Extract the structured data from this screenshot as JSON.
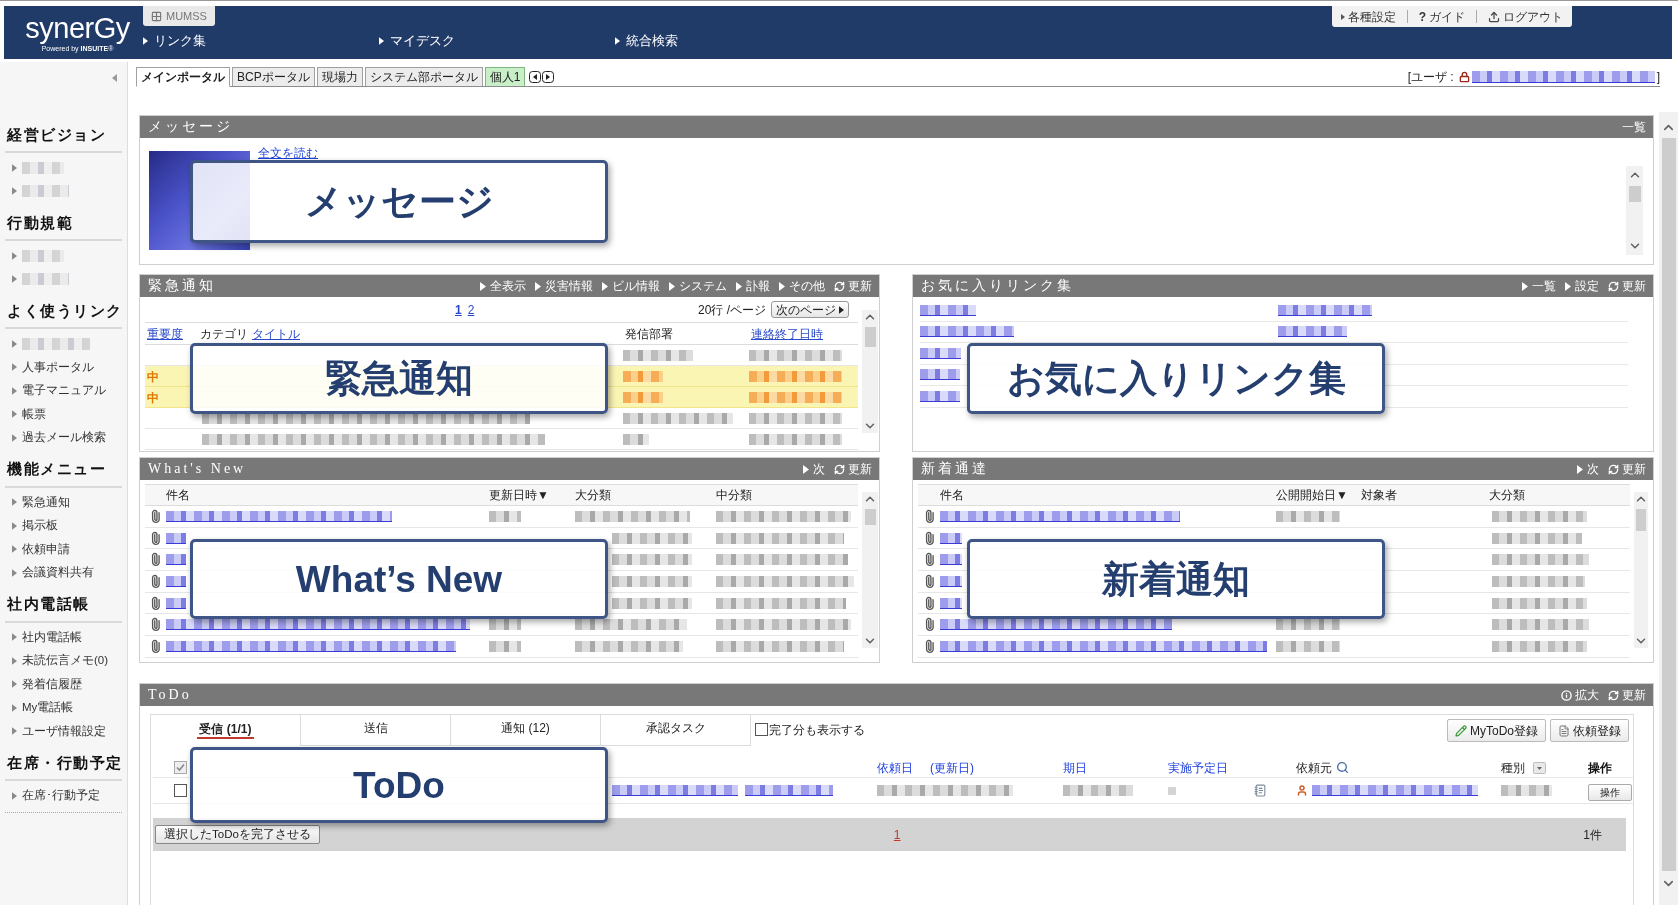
{
  "header": {
    "logo": "synerGy",
    "tagline": "Powered by **INSUITE**®",
    "app_tab": "MUMSS",
    "nav": [
      "リンク集",
      "マイデスク",
      "統合検索"
    ],
    "utility_links": [
      {
        "kind": "settings",
        "label": "各種設定"
      },
      {
        "kind": "guide",
        "symbol": "?",
        "label": "ガイド"
      },
      {
        "kind": "logout",
        "label": "ログアウト"
      }
    ]
  },
  "portal_tabs": [
    {
      "label": "メインポータル",
      "kind": "shared",
      "selected": true
    },
    {
      "label": "BCPポータル",
      "kind": "shared",
      "selected": false
    },
    {
      "label": "現場力",
      "kind": "shared",
      "selected": false
    },
    {
      "label": "システム部ポータル",
      "kind": "shared",
      "selected": false
    },
    {
      "label": "個人1",
      "kind": "personal",
      "selected": false
    }
  ],
  "user": {
    "label": "[ユーザ :",
    "closing": "]"
  },
  "sidebar": {
    "sections": [
      {
        "title": "経営ビジョン",
        "items": [
          {
            "kind": "redacted"
          },
          {
            "kind": "redacted"
          }
        ]
      },
      {
        "title": "行動規範",
        "items": [
          {
            "kind": "redacted"
          },
          {
            "kind": "redacted"
          }
        ]
      },
      {
        "title": "よく使うリンク",
        "items": [
          {
            "kind": "redacted"
          },
          {
            "kind": "link",
            "label": "人事ポータル"
          },
          {
            "kind": "link",
            "label": "電子マニュアル"
          },
          {
            "kind": "link",
            "label": "帳票"
          },
          {
            "kind": "link",
            "label": "過去メール検索"
          }
        ]
      },
      {
        "title": "機能メニュー",
        "items": [
          {
            "kind": "link",
            "label": "緊急通知"
          },
          {
            "kind": "link",
            "label": "掲示板"
          },
          {
            "kind": "link",
            "label": "依頼申請"
          },
          {
            "kind": "link",
            "label": "会議資料共有"
          }
        ]
      },
      {
        "title": "社内電話帳",
        "items": [
          {
            "kind": "link",
            "label": "社内電話帳"
          },
          {
            "kind": "link",
            "label": "未読伝言メモ(0)"
          },
          {
            "kind": "link",
            "label": "発着信履歴"
          },
          {
            "kind": "link",
            "label": "My電話帳"
          },
          {
            "kind": "link",
            "label": "ユーザ情報設定"
          }
        ]
      },
      {
        "title": "在席・行動予定",
        "items": [
          {
            "kind": "link",
            "label": "在席･行動予定"
          }
        ]
      }
    ]
  },
  "message": {
    "title": "メッセージ",
    "list_link": "一覧",
    "read_more": "全文を読む",
    "callout": "メッセージ"
  },
  "emergency": {
    "title": "緊急通知",
    "filters": [
      "全表示",
      "災害情報",
      "ビル情報",
      "システム",
      "訃報",
      "その他"
    ],
    "refresh": "更新",
    "pages": [
      {
        "label": "1",
        "selected": true
      },
      {
        "label": "2",
        "selected": false
      }
    ],
    "per_page": "20行 /ページ",
    "next_page": "次のページ",
    "columns": [
      {
        "label": "重要度",
        "kind": "link"
      },
      {
        "label": "カテゴリ",
        "kind": "plain"
      },
      {
        "label": "タイトル",
        "kind": "link"
      },
      {
        "label": "発信部署",
        "kind": "plain"
      },
      {
        "label": "連絡終了日時",
        "kind": "link"
      }
    ],
    "rows": [
      {
        "highlighted": false
      },
      {
        "importance": "中",
        "highlighted": true
      },
      {
        "importance": "中",
        "highlighted": true
      },
      {
        "highlighted": false
      },
      {
        "highlighted": false
      }
    ],
    "callout": "緊急通知"
  },
  "favorites": {
    "title": "お気に入りリンク集",
    "links": [
      "一覧",
      "設定"
    ],
    "refresh": "更新",
    "rows": [
      {
        "kind": "redacted-links"
      },
      {
        "kind": "redacted-links"
      },
      {
        "kind": "redacted-links"
      },
      {
        "kind": "redacted-links"
      },
      {
        "kind": "redacted-links"
      }
    ],
    "callout": "お気に入りリンク集"
  },
  "whats_new": {
    "title": "What's New",
    "next": "次",
    "refresh": "更新",
    "columns": [
      "件名",
      "更新日時▼",
      "大分類",
      "中分類"
    ],
    "rows": [
      {
        "attachment": true
      },
      {
        "attachment": true
      },
      {
        "attachment": true
      },
      {
        "attachment": true
      },
      {
        "attachment": true
      },
      {
        "attachment": true
      },
      {
        "attachment": true
      }
    ],
    "callout": "What’s New"
  },
  "notices": {
    "title": "新着通達",
    "next": "次",
    "refresh": "更新",
    "columns": [
      "件名",
      "公開開始日▼",
      "対象者",
      "大分類"
    ],
    "rows": [
      {
        "attachment": true
      },
      {
        "attachment": true
      },
      {
        "attachment": true
      },
      {
        "attachment": true
      },
      {
        "attachment": true
      },
      {
        "attachment": true
      },
      {
        "attachment": true
      }
    ],
    "callout": "新着通知"
  },
  "todo": {
    "title": "ToDo",
    "actions": [
      {
        "kind": "info",
        "label": "拡大"
      },
      {
        "kind": "refresh",
        "label": "更新"
      }
    ],
    "tabs": [
      {
        "label": "受信 (1/1)",
        "selected": true
      },
      {
        "label": "送信",
        "selected": false
      },
      {
        "label": "通知 (12)",
        "selected": false
      },
      {
        "label": "承認タスク",
        "selected": false
      }
    ],
    "show_completed": {
      "label": "完了分も表示する",
      "checked": false
    },
    "buttons": [
      {
        "kind": "edit",
        "label": "MyToDo登録"
      },
      {
        "kind": "document",
        "label": "依頼登録"
      }
    ],
    "select_all": {
      "checked": true
    },
    "columns": [
      {
        "label": "依頼日",
        "kind": "sort"
      },
      {
        "label": "(更新日)",
        "kind": "sort"
      },
      {
        "label": "期日",
        "kind": "sort"
      },
      {
        "label": "実施予定日",
        "kind": "sort"
      },
      {
        "label": "依頼元",
        "kind": "search"
      },
      {
        "label": "種別",
        "kind": "dropdown"
      },
      {
        "label": "操作",
        "kind": "bold"
      }
    ],
    "rows": [
      {
        "checked": false,
        "action": "操作"
      }
    ],
    "complete_button": "選択したToDoを完了させる",
    "pages": [
      {
        "label": "1",
        "selected": true
      }
    ],
    "count": "1件",
    "callout": "ToDo"
  }
}
